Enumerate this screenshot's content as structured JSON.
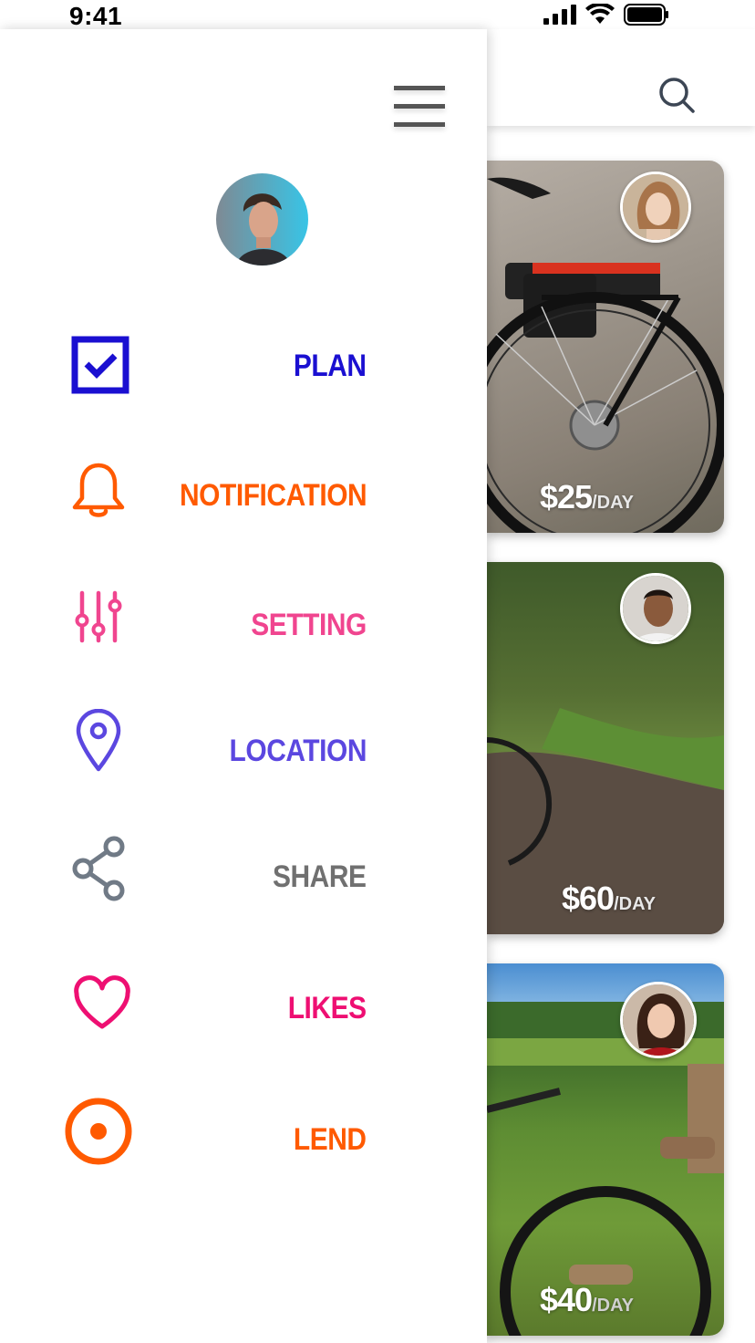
{
  "status_bar": {
    "time": "9:41"
  },
  "drawer": {
    "menu": [
      {
        "key": "plan",
        "label": "PLAN",
        "icon": "checkbox-icon",
        "color": "#1a0fd1"
      },
      {
        "key": "notification",
        "label": "NOTIFICATION",
        "icon": "bell-icon",
        "color": "#ff5a00"
      },
      {
        "key": "setting",
        "label": "SETTING",
        "icon": "sliders-icon",
        "color": "#f0458f"
      },
      {
        "key": "location",
        "label": "LOCATION",
        "icon": "location-pin-icon",
        "color": "#5b47e0"
      },
      {
        "key": "share",
        "label": "SHARE",
        "icon": "share-icon",
        "color": "#707070"
      },
      {
        "key": "likes",
        "label": "LIKES",
        "icon": "heart-icon",
        "color": "#ee0f72"
      },
      {
        "key": "lend",
        "label": "LEND",
        "icon": "target-icon",
        "color": "#ff5a00"
      }
    ]
  },
  "listings": [
    {
      "price": "$25",
      "unit": "/DAY"
    },
    {
      "price": "$60",
      "unit": "/DAY"
    },
    {
      "price": "$40",
      "unit": "/DAY"
    }
  ]
}
